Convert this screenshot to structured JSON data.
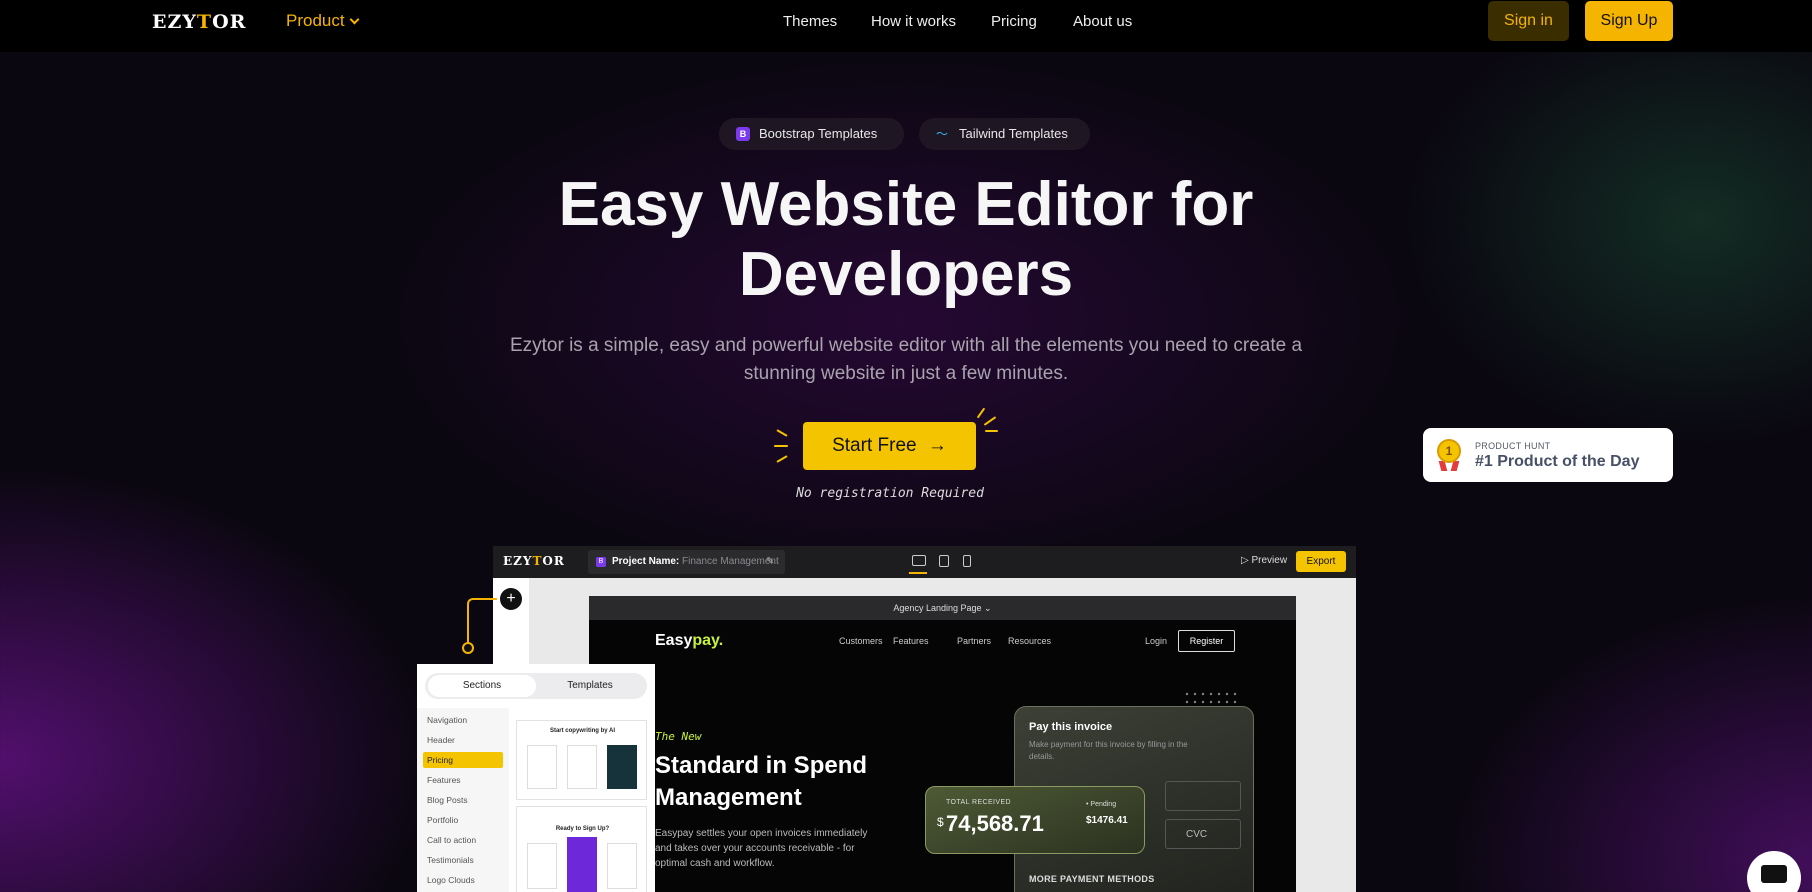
{
  "nav": {
    "logo_pre": "EZY",
    "logo_y": "T",
    "logo_post": "OR",
    "product": "Product",
    "links": [
      "Themes",
      "How it works",
      "Pricing",
      "About us"
    ],
    "signin": "Sign in",
    "signup": "Sign Up"
  },
  "hero": {
    "pill_bootstrap": "Bootstrap Templates",
    "pill_bootstrap_icon": "B",
    "pill_tailwind": "Tailwind Templates",
    "title_line1": "Easy Website Editor for",
    "title_line2": "Developers",
    "subtitle": "Ezytor is a simple, easy and powerful website editor with all the elements you need to create a stunning website in just a few minutes.",
    "cta": "Start Free",
    "cta_icon": "arrow-right-icon",
    "note": "No registration Required"
  },
  "product_hunt": {
    "kicker": "PRODUCT HUNT",
    "title": "#1 Product of the Day",
    "medal_number": "1"
  },
  "editor": {
    "logo_pre": "EZY",
    "logo_y": "T",
    "logo_post": "OR",
    "project_label": "Project Name:",
    "project_value": "Finance Management",
    "project_icon": "B",
    "preview": "Preview",
    "export": "Export",
    "page_select": "Agency Landing Page",
    "site": {
      "brand_pre": "Easy",
      "brand_post": "pay.",
      "nav": [
        "Customers",
        "Features",
        "Partners",
        "Resources"
      ],
      "login": "Login",
      "register": "Register",
      "kicker": "The New",
      "headline": "Standard in Spend Management",
      "body": "Easypay settles your open invoices immediately and takes over your accounts receivable - for optimal cash and workflow.",
      "invoice_title": "Pay this invoice",
      "invoice_desc": "Make payment for this invoice by filling in the details.",
      "cvc": "CVC",
      "more_methods": "MORE PAYMENT METHODS",
      "received_label": "TOTAL RECEIVED",
      "received_currency": "$",
      "received_value": "74,568.71",
      "pending_label": "• Pending",
      "pending_value": "$1476.41"
    },
    "panel": {
      "tab_sections": "Sections",
      "tab_templates": "Templates",
      "items": [
        "Navigation",
        "Header",
        "Pricing",
        "Features",
        "Blog Posts",
        "Portfolio",
        "Call to action",
        "Testimonials",
        "Logo Clouds"
      ],
      "selected": "Pricing",
      "thumb1_title": "Start copywriting by AI",
      "thumb2_title": "Ready to Sign Up?"
    }
  },
  "colors": {
    "accent": "#f5c400",
    "background": "#0a0710",
    "brand_green": "#c7f23c"
  }
}
